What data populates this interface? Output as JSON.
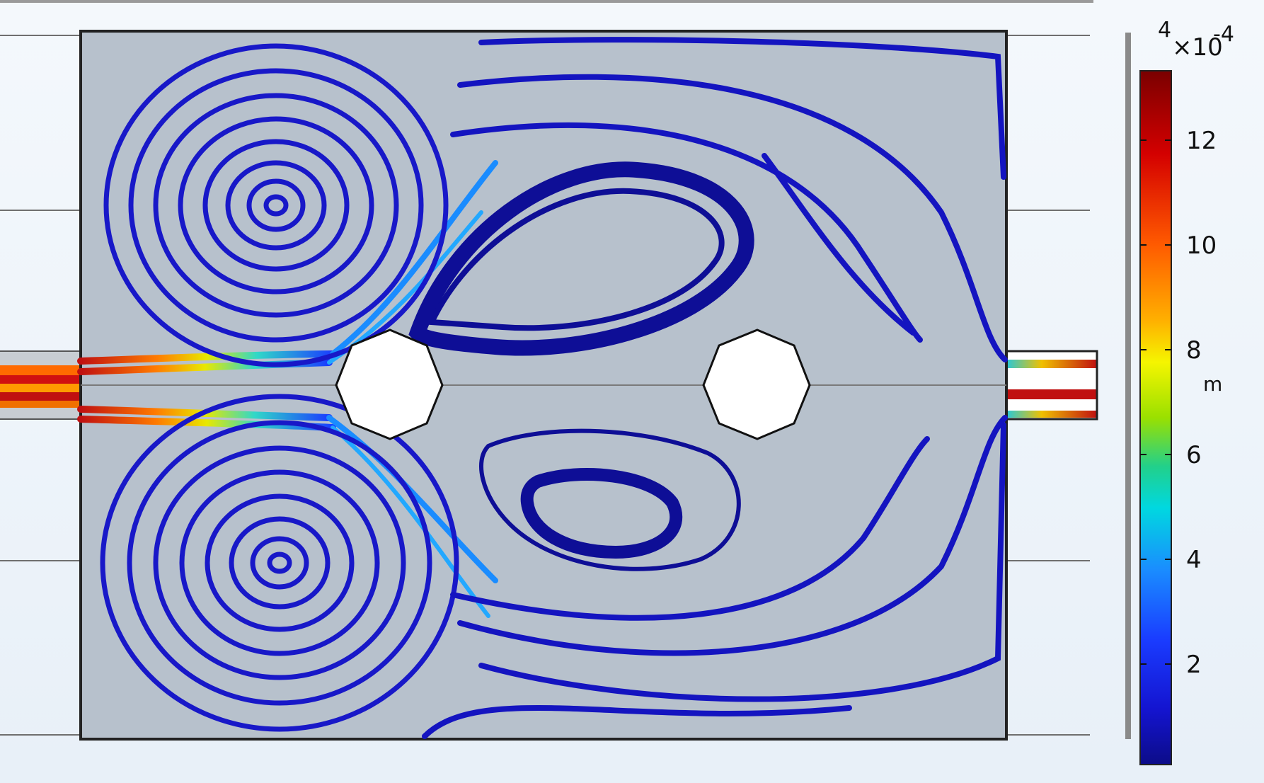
{
  "colorbar": {
    "top_label": "4",
    "multiplier": "×10",
    "exponent": "-4",
    "unit": "m",
    "ticks": [
      "12",
      "10",
      "8",
      "6",
      "4",
      "2"
    ],
    "colors": [
      "#7a0000",
      "#d40000",
      "#ff5a00",
      "#ffb000",
      "#f5f500",
      "#9ae000",
      "#22d08a",
      "#00d8e0",
      "#1a8cff",
      "#1a3cff",
      "#1414d0",
      "#0c0c88"
    ]
  },
  "plot": {
    "domain_fill": "#b7c1cc",
    "streamline_color": "#1616c8"
  }
}
